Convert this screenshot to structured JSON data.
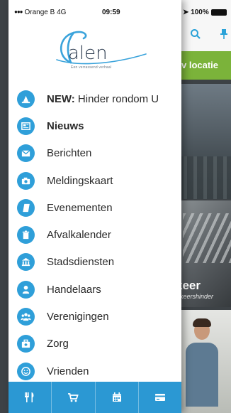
{
  "status": {
    "carrier": "Orange B",
    "network": "4G",
    "time": "09:59",
    "battery": "100%"
  },
  "logo": {
    "word": "alen",
    "tagline": "Een verrassend verhaal"
  },
  "menu": [
    {
      "icon": "alert-icon",
      "label_bold": "NEW:",
      "label": "Hinder rondom U",
      "style": "mixed"
    },
    {
      "icon": "news-icon",
      "label": "Nieuws",
      "style": "bold"
    },
    {
      "icon": "mail-icon",
      "label": "Berichten"
    },
    {
      "icon": "camera-icon",
      "label": "Meldingskaart"
    },
    {
      "icon": "book-icon",
      "label": "Evenementen"
    },
    {
      "icon": "trash-icon",
      "label": "Afvalkalender"
    },
    {
      "icon": "building-icon",
      "label": "Stadsdiensten"
    },
    {
      "icon": "person-icon",
      "label": "Handelaars"
    },
    {
      "icon": "group-icon",
      "label": "Verenigingen"
    },
    {
      "icon": "briefcase-icon",
      "label": "Zorg"
    },
    {
      "icon": "smiley-icon",
      "label": "Vrienden"
    }
  ],
  "bottom_bar": [
    "cutlery-icon",
    "cart-icon",
    "calendar-icon",
    "card-icon"
  ],
  "background": {
    "banner_text": "v locatie",
    "overlay_title": "keer",
    "overlay_sub": "erkeershinder"
  },
  "colors": {
    "accent": "#2f9fd9",
    "bottom_bar": "#2b98d3",
    "banner_green": "#7bb33a"
  }
}
